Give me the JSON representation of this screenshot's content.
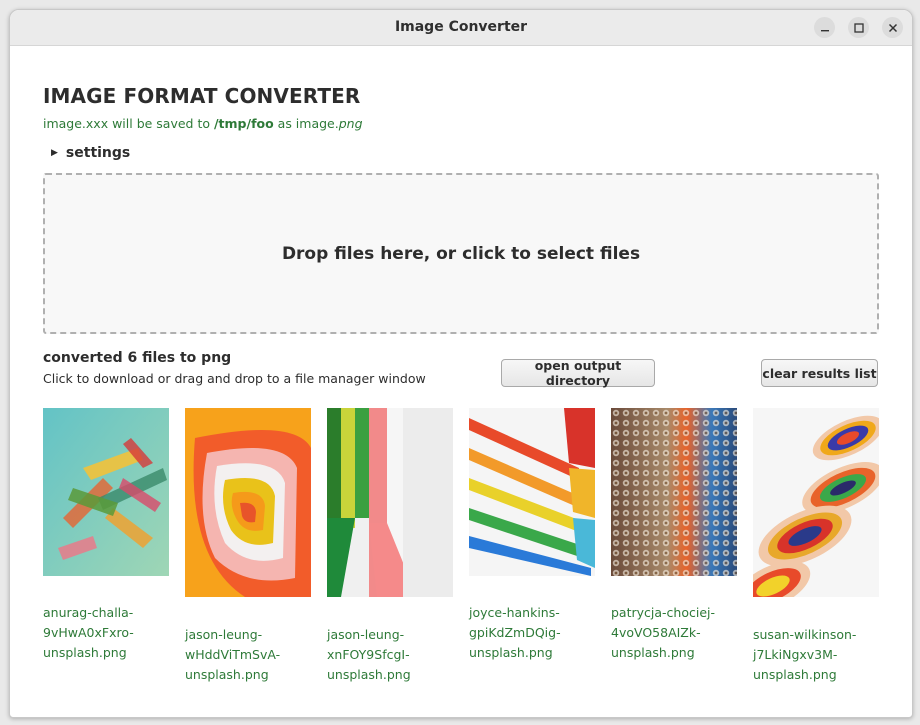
{
  "window": {
    "title": "Image Converter"
  },
  "app": {
    "heading": "IMAGE FORMAT CONVERTER",
    "save_info": {
      "prefix": "image.xxx will be saved to ",
      "directory": "/tmp/foo",
      "middle": " as image.",
      "extension": "png"
    },
    "settings_label": "settings",
    "dropzone_text": "Drop files here, or click to select files"
  },
  "results": {
    "title": "converted 6 files to png",
    "subtitle": "Click to download or drag and drop to a file manager window",
    "open_output_label": "open output directory",
    "clear_label": "clear results list",
    "files": [
      {
        "line1": "anurag-challa-",
        "line2": "9vHwA0xFxro-",
        "line3": "unsplash.png"
      },
      {
        "line1": "jason-leung-",
        "line2": "wHddViTmSvA-",
        "line3": "unsplash.png"
      },
      {
        "line1": "jason-leung-",
        "line2": "xnFOY9SfcgI-",
        "line3": "unsplash.png"
      },
      {
        "line1": "joyce-hankins-",
        "line2": "gpiKdZmDQig-",
        "line3": "unsplash.png"
      },
      {
        "line1": "patrycja-chociej-",
        "line2": "4voVO58AIZk-",
        "line3": "unsplash.png"
      },
      {
        "line1": "susan-wilkinson-",
        "line2": "j7LkiNgxv3M-",
        "line3": "unsplash.png"
      }
    ]
  },
  "colors": {
    "accent_green": "#2e7a38",
    "text": "#2d2d2d"
  }
}
